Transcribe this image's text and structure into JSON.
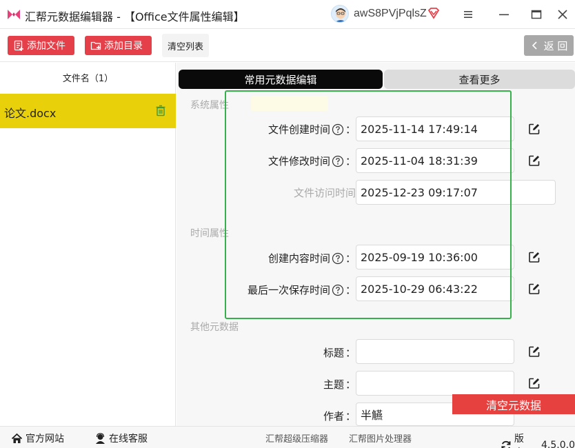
{
  "window": {
    "title": "汇帮元数据编辑器 - 【Office文件属性编辑】",
    "username": "awS8PVjPqlsZ"
  },
  "toolbar": {
    "add_file": "添加文件",
    "add_dir": "添加目录",
    "clear_list": "清空列表",
    "back": "返 回"
  },
  "file_list": {
    "header": "文件名（1）",
    "items": [
      {
        "name": "论文.docx"
      }
    ]
  },
  "tabs": {
    "common": "常用元数据编辑",
    "more": "查看更多"
  },
  "sections": {
    "system": "系统属性",
    "time": "时间属性",
    "other": "其他元数据"
  },
  "fields": {
    "created": {
      "label": "文件创建时间",
      "value": "2025-11-14 17:49:14"
    },
    "modified": {
      "label": "文件修改时间",
      "value": "2025-11-04 18:31:39"
    },
    "accessed": {
      "label": "文件访问时间",
      "value": "2025-12-23 09:17:07"
    },
    "content_created": {
      "label": "创建内容时间",
      "value": "2025-09-19 10:36:00"
    },
    "last_saved": {
      "label": "最后一次保存时间",
      "value": "2025-10-29 06:43:22"
    },
    "title": {
      "label": "标题",
      "value": ""
    },
    "subject": {
      "label": "主题",
      "value": ""
    },
    "author": {
      "label": "作者",
      "value": "半觾"
    }
  },
  "colon": "：",
  "actions": {
    "clear_metadata": "清空元数据"
  },
  "footer": {
    "site": "官方网站",
    "service": "在线客服",
    "compress": "汇帮超级压缩器",
    "image": "汇帮图片处理器",
    "version_label": "版本：",
    "version": "4.5.0.0"
  },
  "colors": {
    "accent_red": "#e5404a",
    "selected_row": "#e8d10b",
    "highlight_green": "#36b04b",
    "tab_active": "#0a0a0a"
  }
}
